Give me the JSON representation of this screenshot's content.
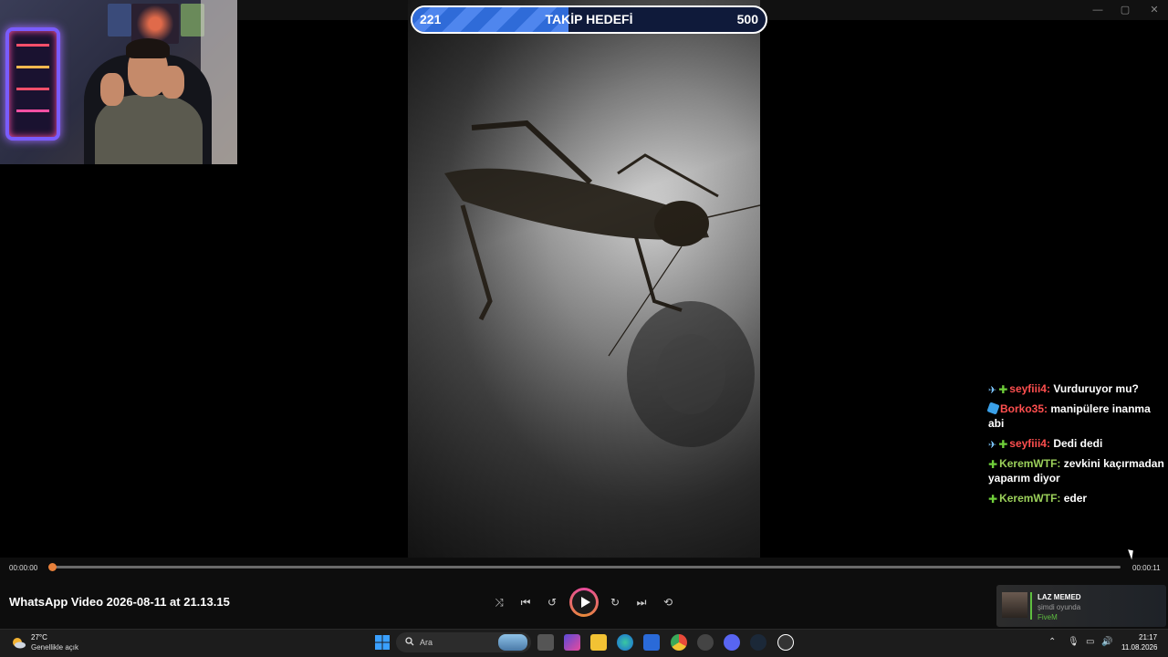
{
  "window": {
    "minimize": "—",
    "maximize": "▢",
    "close": "✕"
  },
  "goal": {
    "current": "221",
    "label": "TAKİP HEDEFİ",
    "target": "500",
    "progress": 0.442
  },
  "chat": [
    {
      "badges": [
        "sword",
        "plus"
      ],
      "user": "seyfiii4",
      "user_color": "#ff4f4f",
      "text": "Vurduruyor mu?"
    },
    {
      "badges": [
        "cube"
      ],
      "user": "Borko35",
      "user_color": "#ff4f4f",
      "text": "manipülere inanma abi"
    },
    {
      "badges": [
        "sword",
        "plus"
      ],
      "user": "seyfiii4",
      "user_color": "#ff4f4f",
      "text": "Dedi dedi"
    },
    {
      "badges": [
        "plus"
      ],
      "user": "KeremWTF",
      "user_color": "#9bd05a",
      "text": "zevkini kaçırmadan yaparım diyor"
    },
    {
      "badges": [
        "plus"
      ],
      "user": "KeremWTF",
      "user_color": "#9bd05a",
      "text": "eder"
    }
  ],
  "player": {
    "current_time": "00:00:00",
    "total_time": "00:00:11",
    "progress": 0.0,
    "title": "WhatsApp Video 2026-08-11 at 21.13.15",
    "controls": [
      "shuffle-icon",
      "previous-icon",
      "rewind-10-icon",
      "play-icon",
      "forward-30-icon",
      "next-icon",
      "repeat-off-icon"
    ]
  },
  "activity": {
    "name": "LAZ MEMED",
    "status": "şimdi oyunda",
    "game": "FiveM"
  },
  "taskbar": {
    "weather_temp": "27°C",
    "weather_desc": "Genellikle açık",
    "search_label": "Ara",
    "clock_time": "21:17",
    "clock_date": "11.08.2026"
  },
  "colors": {
    "accent_orange": "#e8803a",
    "goal_blue": "#3f7ae6",
    "chat_red": "#ff4f4f",
    "chat_green": "#9bd05a"
  }
}
